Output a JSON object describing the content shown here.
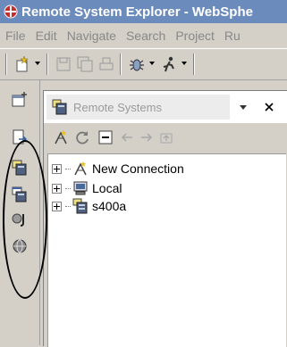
{
  "window": {
    "title": "Remote System Explorer - WebSphe"
  },
  "menubar": {
    "items": [
      "File",
      "Edit",
      "Navigate",
      "Search",
      "Project",
      "Ru"
    ]
  },
  "view": {
    "title": "Remote Systems",
    "tree": [
      {
        "label": "New Connection",
        "icon": "new-connection-icon"
      },
      {
        "label": "Local",
        "icon": "local-computer-icon"
      },
      {
        "label": "s400a",
        "icon": "iseries-system-icon"
      }
    ]
  },
  "colors": {
    "titlebar": "#6c8bbd",
    "annotation_oval": "#000000"
  }
}
